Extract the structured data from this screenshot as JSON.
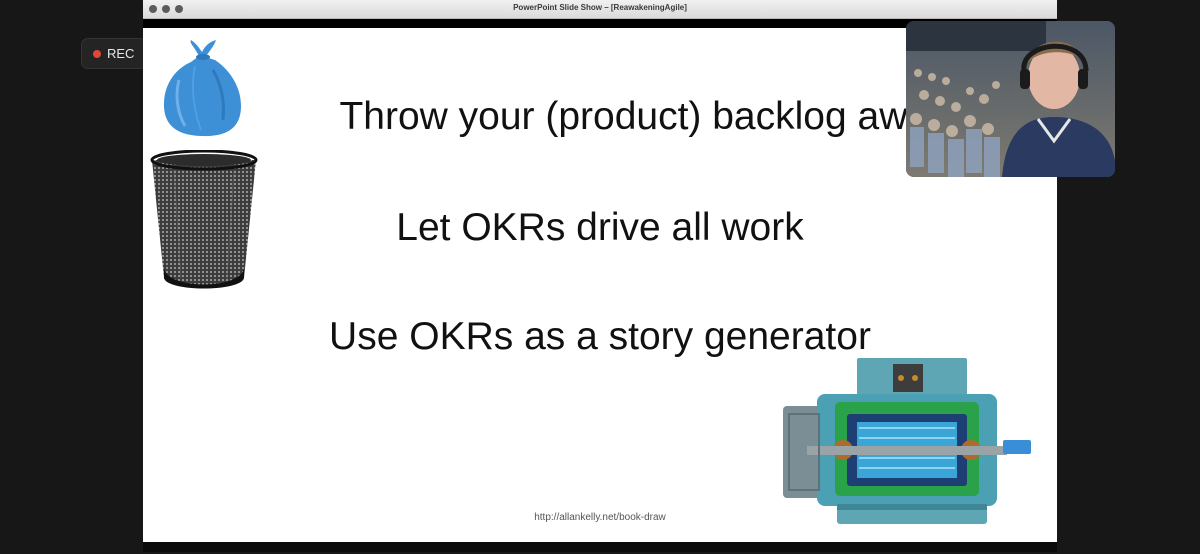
{
  "window": {
    "title": "PowerPoint Slide Show – [ReawakeningAgile]"
  },
  "recording": {
    "label": "REC",
    "indicator_color": "#e0473a"
  },
  "slide": {
    "lines": [
      "Throw your (product) backlog away",
      "Let OKRs drive all work",
      "Use OKRs as a story generator"
    ],
    "url": "http://allankelly.net/book-draw"
  },
  "icons": {
    "bag": "trash-bag-icon",
    "basket": "waste-basket-icon",
    "motor": "electric-motor-icon",
    "speaker": "speaker-video-icon"
  }
}
